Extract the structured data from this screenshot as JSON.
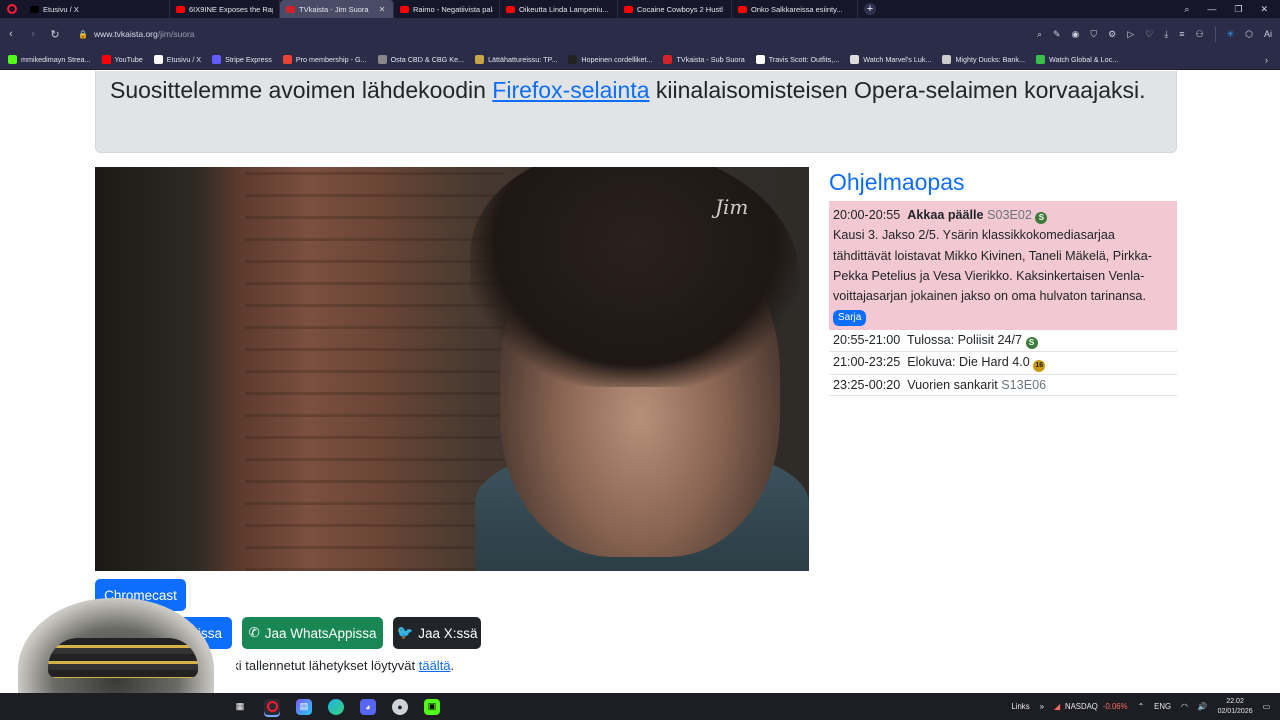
{
  "colors": {
    "accent": "#0d6efd",
    "success": "#198754",
    "dark": "#212529",
    "current_row": "#f2c8d3",
    "browser_chrome": "#2b2c48"
  },
  "tabs": [
    {
      "title": "Etusivu / X",
      "icon": "x-icon",
      "color": "#000000"
    },
    {
      "title": "6IX9INE Exposes the Rap I",
      "icon": "youtube-icon",
      "color": "#ff0000"
    },
    {
      "title": "TVkaista - Jim Suora",
      "icon": "tvkaista-icon",
      "color": "#d2232a",
      "active": true
    },
    {
      "title": "Raimo - Negatiivista pala...",
      "icon": "youtube-icon",
      "color": "#ff0000"
    },
    {
      "title": "Oikeutta Linda Lampeniu...",
      "icon": "youtube-icon",
      "color": "#ff0000"
    },
    {
      "title": "Cocaine Cowboys 2 Hustl",
      "icon": "youtube-icon",
      "color": "#ff0000"
    },
    {
      "title": "Onko Salkkareissa esiinty...",
      "icon": "youtube-icon",
      "color": "#ff0000"
    }
  ],
  "address": {
    "host": "www.tvkaista.org",
    "path": "/jim/suora"
  },
  "bookmarks": [
    {
      "label": "mmikedimayn Strea...",
      "color": "#53fc18"
    },
    {
      "label": "YouTube",
      "color": "#ff0000"
    },
    {
      "label": "Etusivu / X",
      "color": "#ffffff"
    },
    {
      "label": "Stripe Express",
      "color": "#635bff"
    },
    {
      "label": "Pro membership - G...",
      "color": "#ea4335"
    },
    {
      "label": "Osta CBD & CBG Ke...",
      "color": "#888888"
    },
    {
      "label": "Lättähattureissu: TP...",
      "color": "#c9a24a"
    },
    {
      "label": "Hopeinen cordelliket...",
      "color": "#222222"
    },
    {
      "label": "TVkaista - Sub Suora",
      "color": "#d2232a"
    },
    {
      "label": "Travis Scott: Outfits,...",
      "color": "#ffffff"
    },
    {
      "label": "Watch Marvel's Luk...",
      "color": "#dddddd"
    },
    {
      "label": "Mighty Ducks: Bank...",
      "color": "#cccccc"
    },
    {
      "label": "Watch Global & Loc...",
      "color": "#3cbf4a"
    }
  ],
  "alert": {
    "before": "Suosittelemme avoimen lähdekoodin ",
    "link": "Firefox-selainta",
    "after": " kiinalaisomisteisen Opera-selaimen korvaajaksi."
  },
  "video": {
    "watermark": "Jim"
  },
  "guide": {
    "title": "Ohjelmaopas",
    "current": {
      "time": "20:00-20:55",
      "name": "Akkaa päälle",
      "episode": "S03E02",
      "rating": "S",
      "description": "Kausi 3. Jakso 2/5. Ysärin klassikkokomediasarjaa tähdittävät loistavat Mikko Kivinen, Taneli Mäkelä, Pirkka-Pekka Petelius ja Vesa Vierikko. Kaksinkertaisen Venla-voittajasarjan jokainen jakso on oma hulvaton tarinansa.",
      "badge": "Sarja"
    },
    "upcoming": [
      {
        "time": "20:55-21:00",
        "name": "Tulossa: Poliisit 24/7",
        "episode": "",
        "rating": "S"
      },
      {
        "time": "21:00-23:25",
        "name": "Elokuva: Die Hard 4.0",
        "episode": "",
        "rating": "16"
      },
      {
        "time": "23:25-00:20",
        "name": "Vuorien sankarit",
        "episode": "S13E06",
        "rating": ""
      }
    ]
  },
  "buttons": {
    "cast": "Chromecast",
    "facebook": "Jaa Facebookissa",
    "whatsapp": "Jaa WhatsAppissa",
    "x": "Jaa X:ssä"
  },
  "footnote": {
    "text": "Kaikki tallennetut lähetykset löytyvät ",
    "link": "täältä",
    "end": "."
  },
  "taskbar": {
    "links_label": "Links",
    "stock_name": "NASDAQ",
    "stock_change": "-0.06%",
    "lang": "ENG",
    "time": "22.02",
    "date": "02/01/2026"
  }
}
